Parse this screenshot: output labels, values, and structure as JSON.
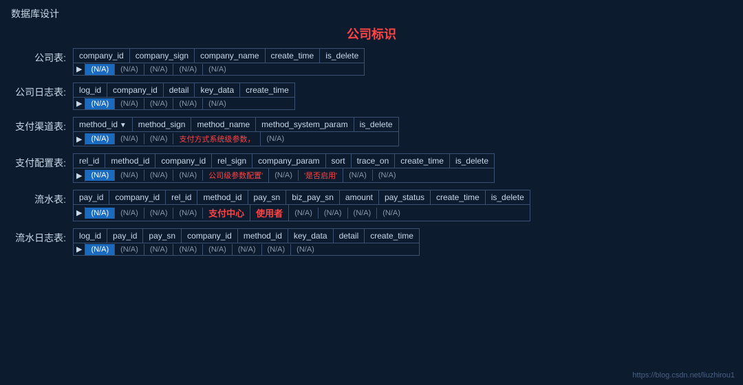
{
  "page": {
    "title": "数据库设计",
    "center_title": "公司标识",
    "watermark": "https://blog.csdn.net/liuzhirou1"
  },
  "tables": [
    {
      "label": "公司表:",
      "columns": [
        "company_id",
        "company_sign",
        "company_name",
        "create_time",
        "is_delete"
      ],
      "row": [
        "(N/A)",
        "(N/A)",
        "(N/A)",
        "(N/A)",
        "(N/A)"
      ],
      "highlighted_col": 0,
      "special_cells": []
    },
    {
      "label": "公司日志表:",
      "columns": [
        "log_id",
        "company_id",
        "detail",
        "key_data",
        "create_time"
      ],
      "row": [
        "(N/A)",
        "(N/A)",
        "(N/A)",
        "(N/A)",
        "(N/A)"
      ],
      "highlighted_col": 0,
      "special_cells": []
    },
    {
      "label": "支付渠道表:",
      "columns": [
        "method_id",
        "method_sign",
        "method_name",
        "method_system_param",
        "is_delete"
      ],
      "row": [
        "(N/A)",
        "(N/A)",
        "(N/A)",
        "支付方式系统级参数，",
        "(N/A)"
      ],
      "highlighted_col": 0,
      "special_cells": [
        3
      ],
      "arrow_col": 0
    },
    {
      "label": "支付配置表:",
      "columns": [
        "rel_id",
        "method_id",
        "company_id",
        "rel_sign",
        "company_param",
        "sort",
        "trace_on",
        "create_time",
        "is_delete"
      ],
      "row": [
        "(N/A)",
        "(N/A)",
        "(N/A)",
        "(N/A)",
        "公司级参数配置'",
        "(N/A)",
        "'是否启用'",
        "(N/A)",
        "(N/A)"
      ],
      "highlighted_col": 0,
      "special_cells": [
        4,
        6
      ]
    },
    {
      "label": "流水表:",
      "columns": [
        "pay_id",
        "company_id",
        "rel_id",
        "method_id",
        "pay_sn",
        "biz_pay_sn",
        "amount",
        "pay_status",
        "create_time",
        "is_delete"
      ],
      "row": [
        "(N/A)",
        "(N/A)",
        "(N/A)",
        "(N/A)",
        "支付中心",
        "使用者",
        "(N/A)",
        "(N/A)",
        "(N/A)",
        "(N/A)"
      ],
      "highlighted_col": 0,
      "special_cells": [
        4,
        5
      ],
      "inline_red": [
        4,
        5
      ]
    },
    {
      "label": "流水日志表:",
      "columns": [
        "log_id",
        "pay_id",
        "pay_sn",
        "company_id",
        "method_id",
        "key_data",
        "detail",
        "create_time"
      ],
      "row": [
        "(N/A)",
        "(N/A)",
        "(N/A)",
        "(N/A)",
        "(N/A)",
        "(N/A)",
        "(N/A)",
        "(N/A)"
      ],
      "highlighted_col": 0,
      "special_cells": []
    }
  ]
}
